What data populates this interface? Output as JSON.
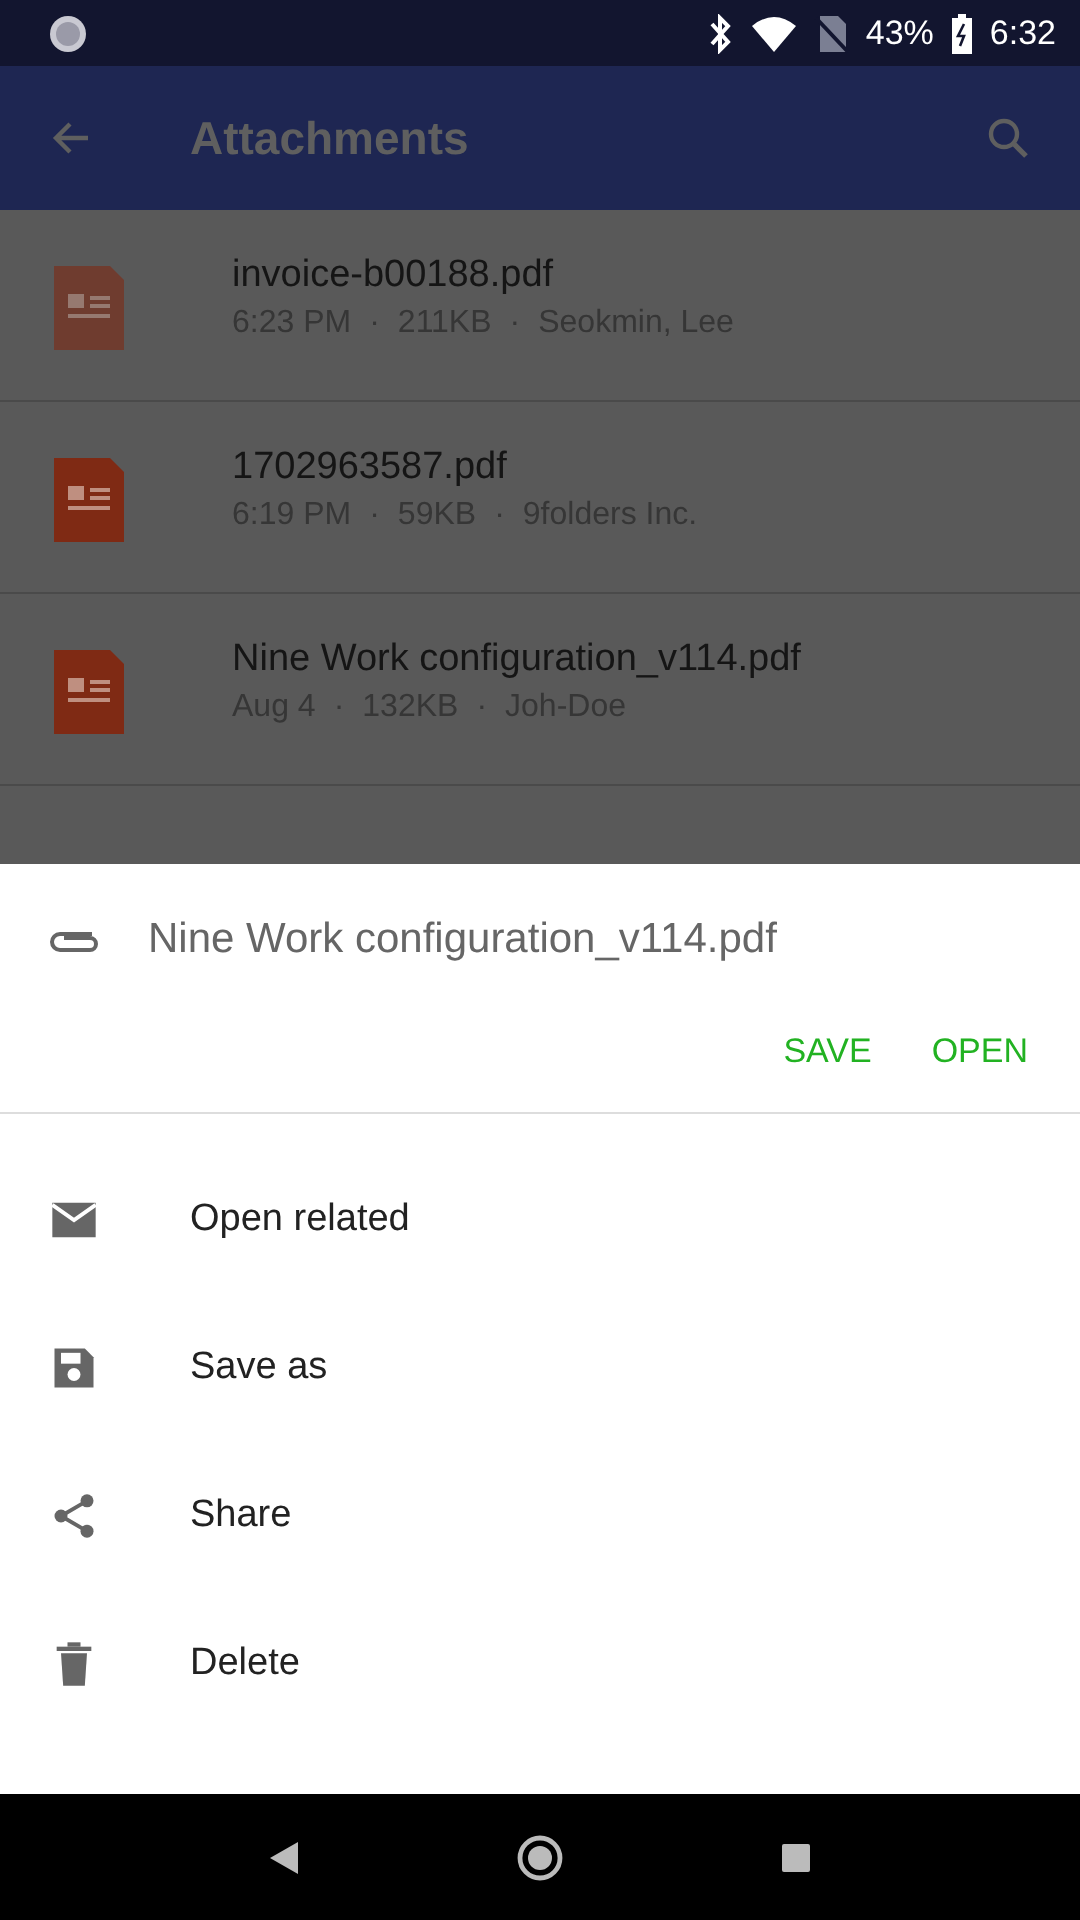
{
  "status_bar": {
    "battery": "43%",
    "time": "6:32"
  },
  "app_bar": {
    "title": "Attachments"
  },
  "attachments": [
    {
      "name": "invoice-b00188.pdf",
      "time": "6:23 PM",
      "size": "211KB",
      "sender": "Seokmin, Lee",
      "separator": "·",
      "faded": true
    },
    {
      "name": "1702963587.pdf",
      "time": "6:19 PM",
      "size": "59KB",
      "sender": "9folders Inc.",
      "separator": "·",
      "faded": false
    },
    {
      "name": "Nine Work configuration_v114.pdf",
      "time": "Aug 4",
      "size": "132KB",
      "sender": "Joh-Doe",
      "separator": "·",
      "faded": false
    }
  ],
  "sheet": {
    "file_name": "Nine Work configuration_v114.pdf",
    "buttons": [
      "SAVE",
      "OPEN"
    ],
    "actions": [
      {
        "kind": "mail",
        "label": "Open related"
      },
      {
        "kind": "save",
        "label": "Save as"
      },
      {
        "kind": "share",
        "label": "Share"
      },
      {
        "kind": "delete",
        "label": "Delete"
      }
    ]
  }
}
